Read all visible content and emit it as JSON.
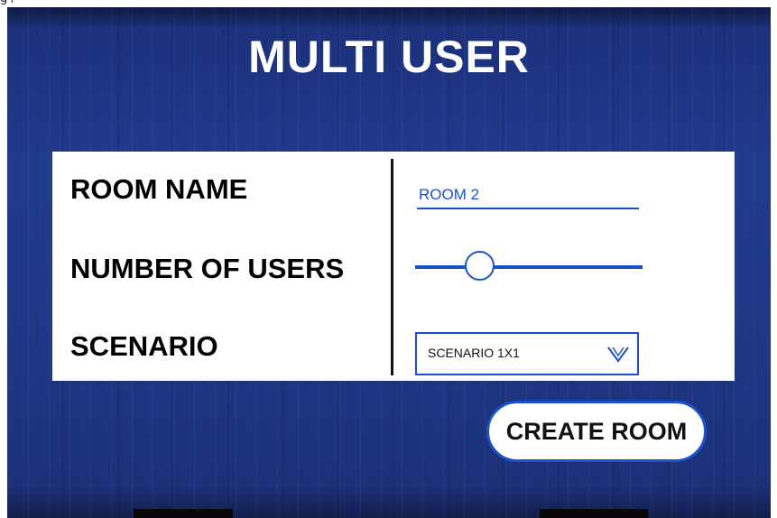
{
  "corner_text": "g /",
  "title": "MULTI USER",
  "form": {
    "room_name_label": "ROOM NAME",
    "room_name_value": "ROOM 2",
    "num_users_label": "NUMBER OF USERS",
    "num_users_slider_fraction": 0.25,
    "scenario_label": "SCENARIO",
    "scenario_value": "SCENARIO 1X1",
    "scenario_icon": "chevron-down-icon"
  },
  "create_button_label": "CREATE ROOM",
  "colors": {
    "accent": "#1c52c9",
    "background": "#1f3888",
    "panel": "#ffffff"
  }
}
